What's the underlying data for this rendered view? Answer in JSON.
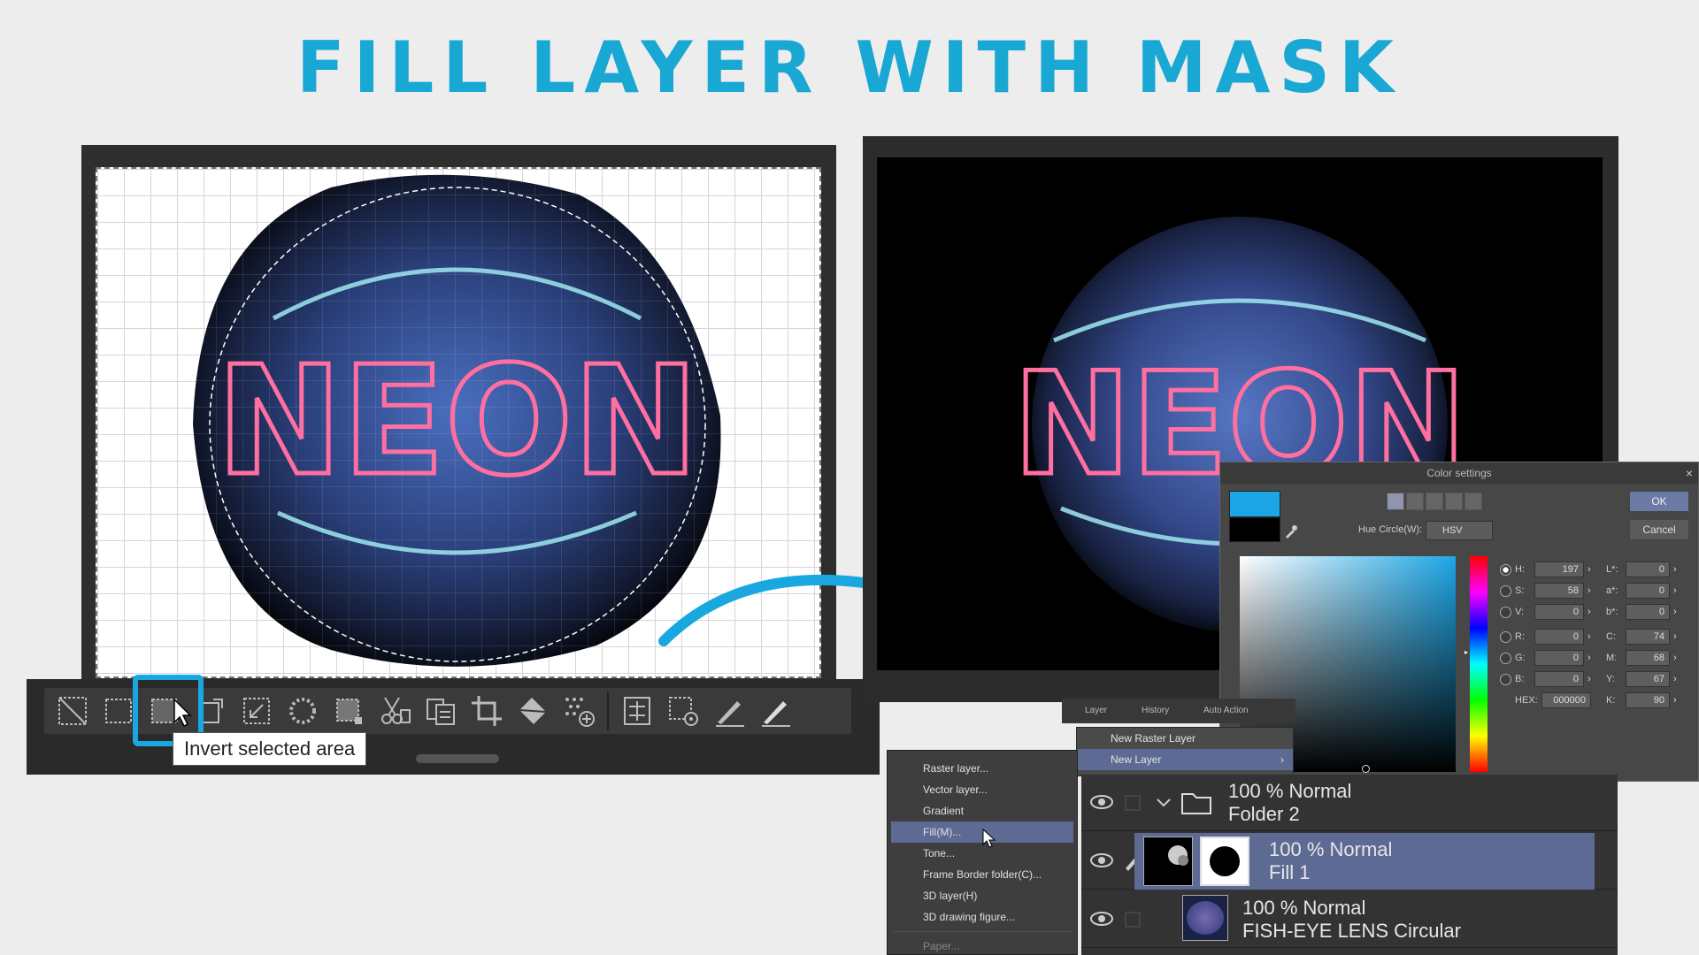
{
  "title": "FILL LAYER WITH MASK",
  "art": {
    "text": "NEON"
  },
  "toolbar": {
    "icons": [
      "deselect-icon",
      "rectangle-select-icon",
      "invert-selection-icon",
      "expand-selection-icon",
      "shrink-selection-icon",
      "selection-border-icon",
      "select-rect-icon",
      "cut-paste-icon",
      "copy-paste-icon",
      "crop-icon",
      "fill-icon",
      "dots-icon",
      "selection-launcher-icon",
      "settings-icon",
      "pen-icon",
      "pen2-icon"
    ],
    "tooltip": "Invert selected area"
  },
  "color_settings": {
    "title": "Color settings",
    "close": "×",
    "ok": "OK",
    "cancel": "Cancel",
    "hue_label": "Hue Circle(W):",
    "hue_value": "HSV",
    "fields_left": [
      {
        "label": "H:",
        "value": "197"
      },
      {
        "label": "S:",
        "value": "58"
      },
      {
        "label": "V:",
        "value": "0"
      },
      {
        "label": "R:",
        "value": "0"
      },
      {
        "label": "G:",
        "value": "0"
      },
      {
        "label": "B:",
        "value": "0"
      }
    ],
    "fields_right": [
      {
        "label": "L*:",
        "value": "0"
      },
      {
        "label": "a*:",
        "value": "0"
      },
      {
        "label": "b*:",
        "value": "0"
      },
      {
        "label": "C:",
        "value": "74"
      },
      {
        "label": "M:",
        "value": "68"
      },
      {
        "label": "Y:",
        "value": "67"
      },
      {
        "label": "K:",
        "value": "90"
      }
    ],
    "hex_label": "HEX:",
    "hex_value": "000000",
    "main_color": "#1da6e6"
  },
  "layer_panel": {
    "tabs": [
      "Layer",
      "History",
      "Auto Action"
    ],
    "menu": [
      "New Raster Layer",
      "New Layer"
    ],
    "layers": [
      {
        "mode": "100 % Normal",
        "name": "Folder 2"
      },
      {
        "mode": "100 % Normal",
        "name": "Fill 1"
      },
      {
        "mode": "100 % Normal",
        "name": "FISH-EYE LENS Circular"
      }
    ]
  },
  "submenu": {
    "items": [
      "Raster layer...",
      "Vector layer...",
      "Gradient",
      "Fill(M)...",
      "Tone...",
      "Frame Border folder(C)...",
      "3D layer(H)",
      "3D drawing figure...",
      "Paper..."
    ]
  }
}
